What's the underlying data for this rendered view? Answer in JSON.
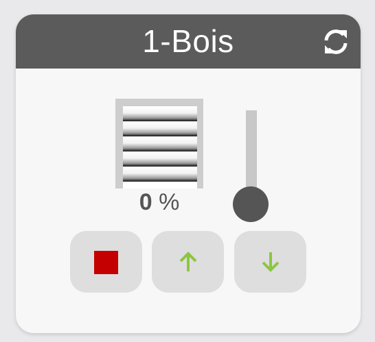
{
  "widget": {
    "title": "1-Bois",
    "position": {
      "value": "0",
      "unit": "%"
    },
    "slider_level": 0
  },
  "icons": {
    "refresh": "refresh-icon",
    "stop": "stop-icon",
    "up": "arrow-up-icon",
    "down": "arrow-down-icon"
  },
  "colors": {
    "header_bg": "#5b5b5b",
    "card_bg": "#f7f7f7",
    "stop_red": "#c40000",
    "arrow_green": "#8cc63f",
    "slider_thumb": "#555555"
  }
}
